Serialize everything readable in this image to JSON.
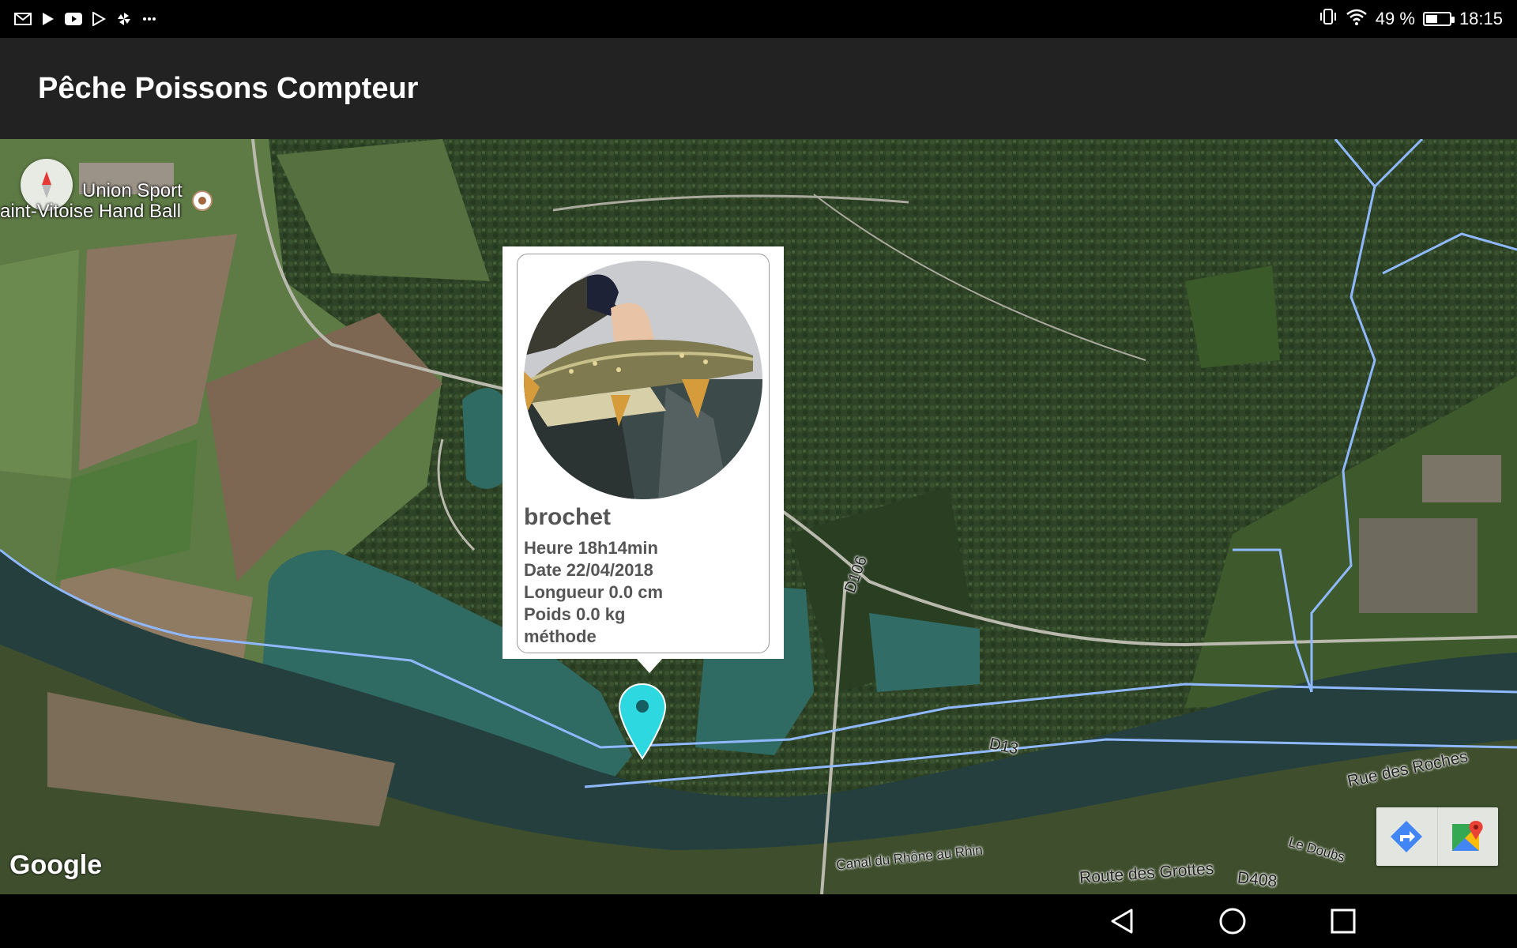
{
  "status_bar": {
    "battery_text": "49 %",
    "battery_level": 0.49,
    "time": "18:15",
    "left_icons": [
      "gmail-icon",
      "play-store-icon",
      "youtube-icon",
      "play-movies-icon",
      "pinwheel-icon",
      "more-dots-icon"
    ],
    "right_icons": [
      "vibrate-icon",
      "wifi-icon",
      "battery-icon"
    ]
  },
  "app_bar": {
    "title": "Pêche Poissons Compteur"
  },
  "map": {
    "place_labels": {
      "union_sport_line1": "Union Sport",
      "union_sport_line2": "aint-Vitoise Hand Ball"
    },
    "road_labels": {
      "d106": "D106",
      "d13": "D13",
      "rue_des_roches": "Rue des Roches",
      "canal": "Canal du Rhône au Rhin",
      "le_doubs": "Le Doubs",
      "route_des_grottes": "Route des Grottes",
      "d408": "D408"
    },
    "attribution": "Google",
    "marker_color": "#2ed8e0"
  },
  "info_window": {
    "species": "brochet",
    "lines": {
      "time": "Heure 18h14min",
      "date": "Date 22/04/2018",
      "length": "Longueur 0.0 cm",
      "weight": "Poids 0.0 kg",
      "method": "méthode"
    }
  },
  "nav_bar": {
    "icons": [
      "back-icon",
      "home-icon",
      "recents-icon"
    ]
  }
}
